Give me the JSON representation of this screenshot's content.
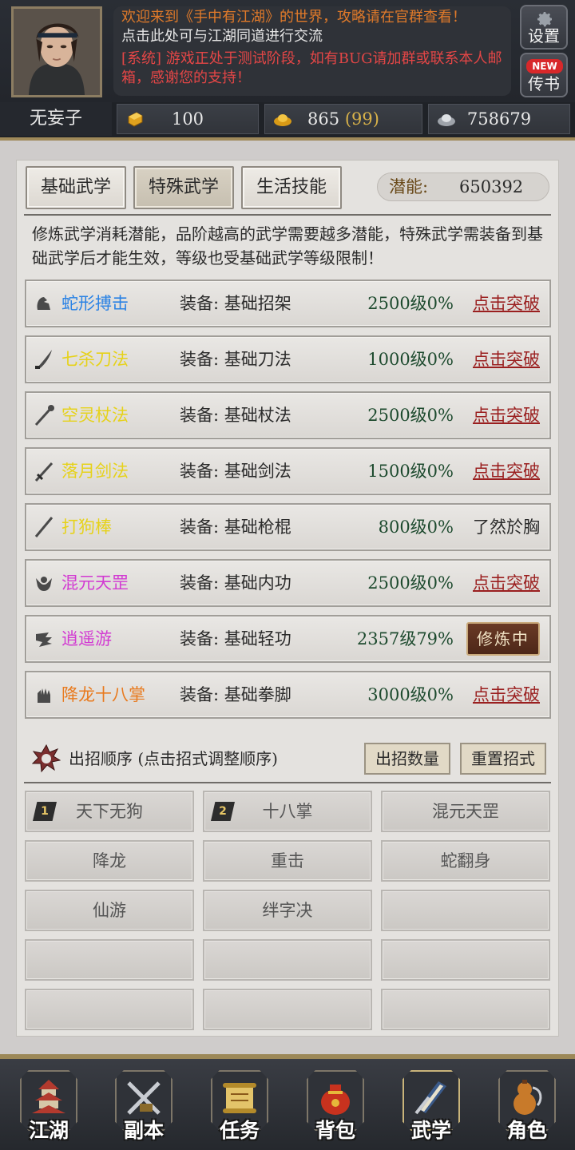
{
  "header": {
    "welcome": "欢迎来到《手中有江湖》的世界，攻略请在官群查看！",
    "chat_prompt": "点击此处可与江湖同道进行交流",
    "system_tag": "[系统]",
    "system_text": " 游戏正处于测试阶段，如有BUG请加群或联系本人邮箱，感谢您的支持！",
    "settings_label": "设置",
    "letter_label": "传书",
    "new_badge": "NEW"
  },
  "player": {
    "name": "无妄子",
    "res1": "100",
    "res2": "865",
    "res2_extra": "(99)",
    "res3": "758679"
  },
  "tabs": [
    "基础武学",
    "特殊武学",
    "生活技能"
  ],
  "active_tab": "特殊武学",
  "potential": {
    "label": "潜能:",
    "value": "650392"
  },
  "description": "修炼武学消耗潜能，品阶越高的武学需要越多潜能，特殊武学需装备到基础武学后才能生效，等级也受基础武学等级限制！",
  "skills": [
    {
      "name": "蛇形搏击",
      "color": "#2a82e4",
      "icon": "fist-grip-icon",
      "equip": "装备: 基础招架",
      "level": "2500级0%",
      "action": "点击突破",
      "action_type": "break"
    },
    {
      "name": "七杀刀法",
      "color": "#e6d21a",
      "icon": "saber-icon",
      "equip": "装备: 基础刀法",
      "level": "1000级0%",
      "action": "点击突破",
      "action_type": "break"
    },
    {
      "name": "空灵杖法",
      "color": "#e6d21a",
      "icon": "staff-icon",
      "equip": "装备: 基础杖法",
      "level": "2500级0%",
      "action": "点击突破",
      "action_type": "break"
    },
    {
      "name": "落月剑法",
      "color": "#e6d21a",
      "icon": "sword-icon",
      "equip": "装备: 基础剑法",
      "level": "1500级0%",
      "action": "点击突破",
      "action_type": "break"
    },
    {
      "name": "打狗棒",
      "color": "#e6d21a",
      "icon": "stick-icon",
      "equip": "装备: 基础枪棍",
      "level": "800级0%",
      "action": "了然於胸",
      "action_type": "plain"
    },
    {
      "name": "混元天罡",
      "color": "#d23ad2",
      "icon": "inner-power-icon",
      "equip": "装备: 基础内功",
      "level": "2500级0%",
      "action": "点击突破",
      "action_type": "break"
    },
    {
      "name": "逍遥游",
      "color": "#d23ad2",
      "icon": "wind-icon",
      "equip": "装备: 基础轻功",
      "level": "2357级79%",
      "action": "修炼中",
      "action_type": "training"
    },
    {
      "name": "降龙十八掌",
      "color": "#e87a1e",
      "icon": "palm-icon",
      "equip": "装备: 基础拳脚",
      "level": "3000级0%",
      "action": "点击突破",
      "action_type": "break"
    }
  ],
  "order": {
    "title": "出招顺序 (点击招式调整顺序)",
    "count_button": "出招数量",
    "reset_button": "重置招式",
    "slots": [
      {
        "num": "1",
        "label": "天下无狗"
      },
      {
        "num": "2",
        "label": "十八掌"
      },
      {
        "num": "",
        "label": "混元天罡"
      },
      {
        "num": "",
        "label": "降龙"
      },
      {
        "num": "",
        "label": "重击"
      },
      {
        "num": "",
        "label": "蛇翻身"
      },
      {
        "num": "",
        "label": "仙游"
      },
      {
        "num": "",
        "label": "绊字决"
      },
      {
        "num": "",
        "label": ""
      },
      {
        "num": "",
        "label": ""
      },
      {
        "num": "",
        "label": ""
      },
      {
        "num": "",
        "label": ""
      },
      {
        "num": "",
        "label": ""
      },
      {
        "num": "",
        "label": ""
      },
      {
        "num": "",
        "label": ""
      }
    ]
  },
  "nav": [
    {
      "label": "江湖",
      "icon": "pagoda-icon"
    },
    {
      "label": "副本",
      "icon": "crossed-swords-icon"
    },
    {
      "label": "任务",
      "icon": "scroll-icon"
    },
    {
      "label": "背包",
      "icon": "bag-icon"
    },
    {
      "label": "武学",
      "icon": "book-icon"
    },
    {
      "label": "角色",
      "icon": "gourd-icon"
    }
  ],
  "active_nav": "武学"
}
